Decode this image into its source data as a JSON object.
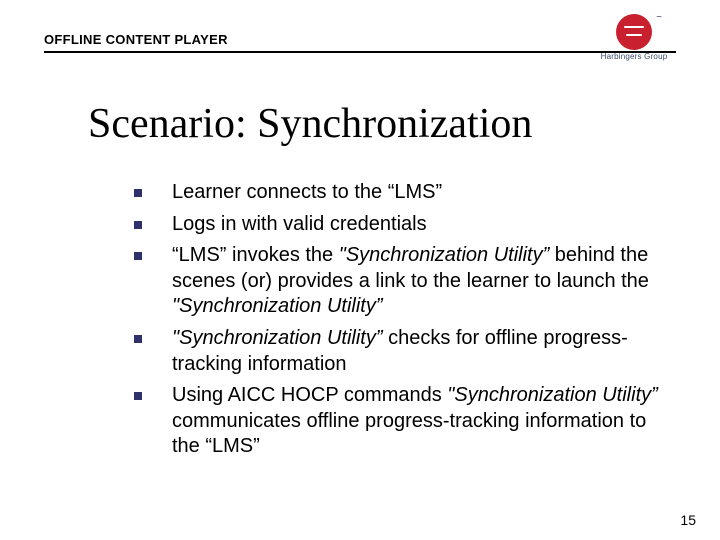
{
  "header": {
    "title": "OFFLINE CONTENT PLAYER",
    "logo_text": "Harbingers Group"
  },
  "slide": {
    "title": "Scenario: Synchronization",
    "bullets": [
      {
        "pre": "Learner connects to the “LMS”",
        "it1": "",
        "mid": "",
        "it2": "",
        "post": ""
      },
      {
        "pre": "Logs in with valid credentials",
        "it1": "",
        "mid": "",
        "it2": "",
        "post": ""
      },
      {
        "pre": "“LMS” invokes the ",
        "it1": "\"Synchronization Utility”",
        "mid": " behind the scenes (or) provides a link to the learner to launch the ",
        "it2": "\"Synchronization Utility”",
        "post": ""
      },
      {
        "pre": "",
        "it1": "\"Synchronization Utility”",
        "mid": " checks for offline progress-tracking information",
        "it2": "",
        "post": ""
      },
      {
        "pre": "Using AICC HOCP commands ",
        "it1": "\"Synchronization Utility”",
        "mid": " communicates offline progress-tracking information to the “LMS”",
        "it2": "",
        "post": ""
      }
    ],
    "page_number": "15"
  }
}
